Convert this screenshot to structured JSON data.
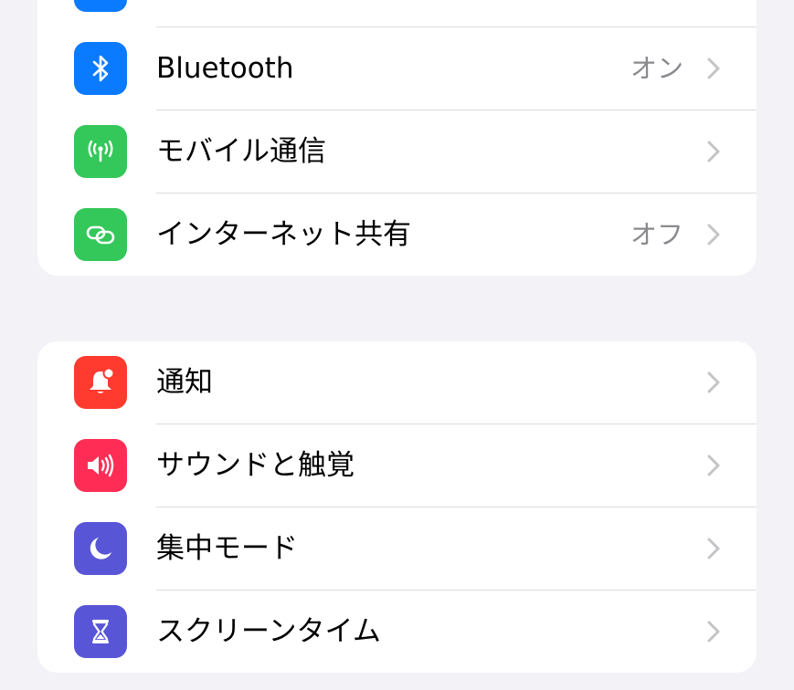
{
  "colors": {
    "background": "#f2f2f7",
    "card": "#ffffff",
    "blue": "#0a7aff",
    "green": "#34c759",
    "red": "#ff3b30",
    "pink": "#ff2d55",
    "indigo": "#5856d6",
    "secondary_text": "#8a8a8e",
    "chevron": "#c4c4c7"
  },
  "groups": [
    {
      "name": "connectivity",
      "items": [
        {
          "label": "",
          "value": "",
          "icon": "partial-blue-icon"
        },
        {
          "label": "Bluetooth",
          "value": "オン",
          "icon": "bluetooth-icon"
        },
        {
          "label": "モバイル通信",
          "value": "",
          "icon": "antenna-icon"
        },
        {
          "label": "インターネット共有",
          "value": "オフ",
          "icon": "link-icon"
        }
      ]
    },
    {
      "name": "system",
      "items": [
        {
          "label": "通知",
          "value": "",
          "icon": "bell-icon"
        },
        {
          "label": "サウンドと触覚",
          "value": "",
          "icon": "speaker-icon"
        },
        {
          "label": "集中モード",
          "value": "",
          "icon": "moon-icon"
        },
        {
          "label": "スクリーンタイム",
          "value": "",
          "icon": "hourglass-icon"
        }
      ]
    }
  ]
}
